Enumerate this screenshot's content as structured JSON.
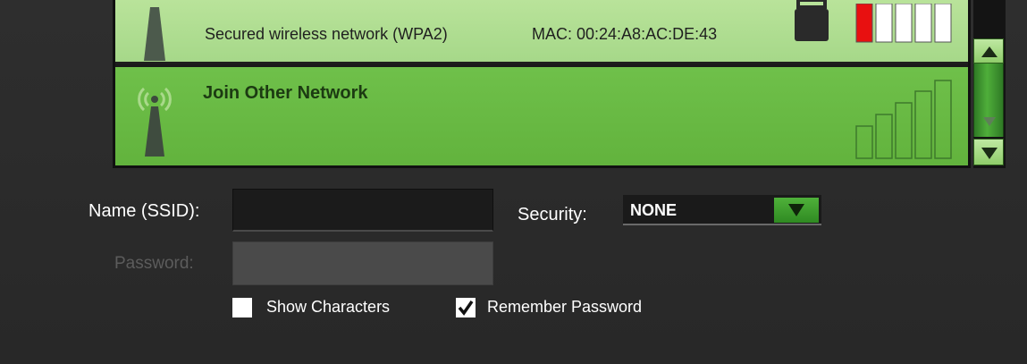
{
  "networks": [
    {
      "security_desc": "Secured wireless network (WPA2)",
      "mac": "MAC: 00:24:A8:AC:DE:43",
      "icon": "antenna-icon",
      "lock_icon": "lock-icon",
      "signal_level": 0.2
    },
    {
      "label": "Join Other Network",
      "icon": "antenna-wifi-icon",
      "signal_level": 0
    }
  ],
  "scrollbar": {
    "up_icon": "arrow-up-icon",
    "down_icon": "arrow-down-icon"
  },
  "form": {
    "ssid_label": "Name (SSID):",
    "ssid_value": "",
    "security_label": "Security:",
    "security_value": "NONE",
    "password_label": "Password:",
    "password_value": "",
    "show_characters_label": "Show Characters",
    "show_characters_checked": false,
    "remember_password_label": "Remember Password",
    "remember_password_checked": true
  },
  "colors": {
    "row_secured_bg": "#b9e39a",
    "row_join_bg": "#6fc04a",
    "signal_red": "#e81010",
    "accent_green": "#3da02c",
    "panel_bg": "#2b2b2b"
  }
}
